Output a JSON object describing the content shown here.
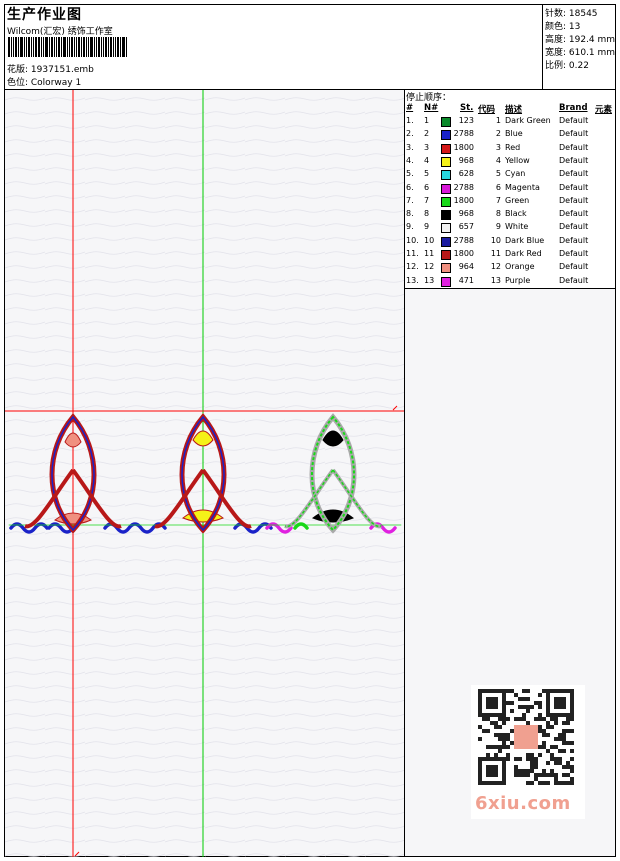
{
  "header": {
    "title": "生产作业图",
    "company": "Wilcom(汇宏) 绣饰工作室",
    "design_label": "花版: 1937151.emb",
    "colorway_label": "色位: Colorway 1"
  },
  "specs": {
    "stitches": "针数: 18545",
    "colors": "颜色: 13",
    "height": "高度: 192.4 mm",
    "width": "宽度: 610.1 mm",
    "scale": "比例: 0.22"
  },
  "stop_sequence": {
    "title": "停止顺序：",
    "headers": {
      "index": "#",
      "no": "N#",
      "stitches": "St.",
      "code": "代码",
      "desc": "描述",
      "brand": "Brand",
      "element": "元素"
    },
    "rows": [
      {
        "index": "1.",
        "no": "1",
        "color": "#0a8a2a",
        "stitches": "123",
        "code": "1",
        "desc": "Dark Green",
        "brand": "Default"
      },
      {
        "index": "2.",
        "no": "2",
        "color": "#1a22c8",
        "stitches": "2788",
        "code": "2",
        "desc": "Blue",
        "brand": "Default"
      },
      {
        "index": "3.",
        "no": "3",
        "color": "#d41818",
        "stitches": "1800",
        "code": "3",
        "desc": "Red",
        "brand": "Default"
      },
      {
        "index": "4.",
        "no": "4",
        "color": "#f5f218",
        "stitches": "968",
        "code": "4",
        "desc": "Yellow",
        "brand": "Default"
      },
      {
        "index": "5.",
        "no": "5",
        "color": "#28d8e0",
        "stitches": "628",
        "code": "5",
        "desc": "Cyan",
        "brand": "Default"
      },
      {
        "index": "6.",
        "no": "6",
        "color": "#d818d8",
        "stitches": "2788",
        "code": "6",
        "desc": "Magenta",
        "brand": "Default"
      },
      {
        "index": "7.",
        "no": "7",
        "color": "#18d818",
        "stitches": "1800",
        "code": "7",
        "desc": "Green",
        "brand": "Default"
      },
      {
        "index": "8.",
        "no": "8",
        "color": "#000000",
        "stitches": "968",
        "code": "8",
        "desc": "Black",
        "brand": "Default"
      },
      {
        "index": "9.",
        "no": "9",
        "color": "#f2f2f2",
        "stitches": "657",
        "code": "9",
        "desc": "White",
        "brand": "Default"
      },
      {
        "index": "10.",
        "no": "10",
        "color": "#1a1aa0",
        "stitches": "2788",
        "code": "10",
        "desc": "Dark Blue",
        "brand": "Default"
      },
      {
        "index": "11.",
        "no": "11",
        "color": "#b81818",
        "stitches": "1800",
        "code": "11",
        "desc": "Dark Red",
        "brand": "Default"
      },
      {
        "index": "12.",
        "no": "12",
        "color": "#f09080",
        "stitches": "964",
        "code": "12",
        "desc": "Orange",
        "brand": "Default"
      },
      {
        "index": "13.",
        "no": "13",
        "color": "#e020e0",
        "stitches": "471",
        "code": "13",
        "desc": "Purple",
        "brand": "Default"
      }
    ]
  },
  "watermark": {
    "text": "6xiu.com"
  },
  "guide_colors": {
    "red": "#ff0000",
    "green": "#00cc00"
  }
}
